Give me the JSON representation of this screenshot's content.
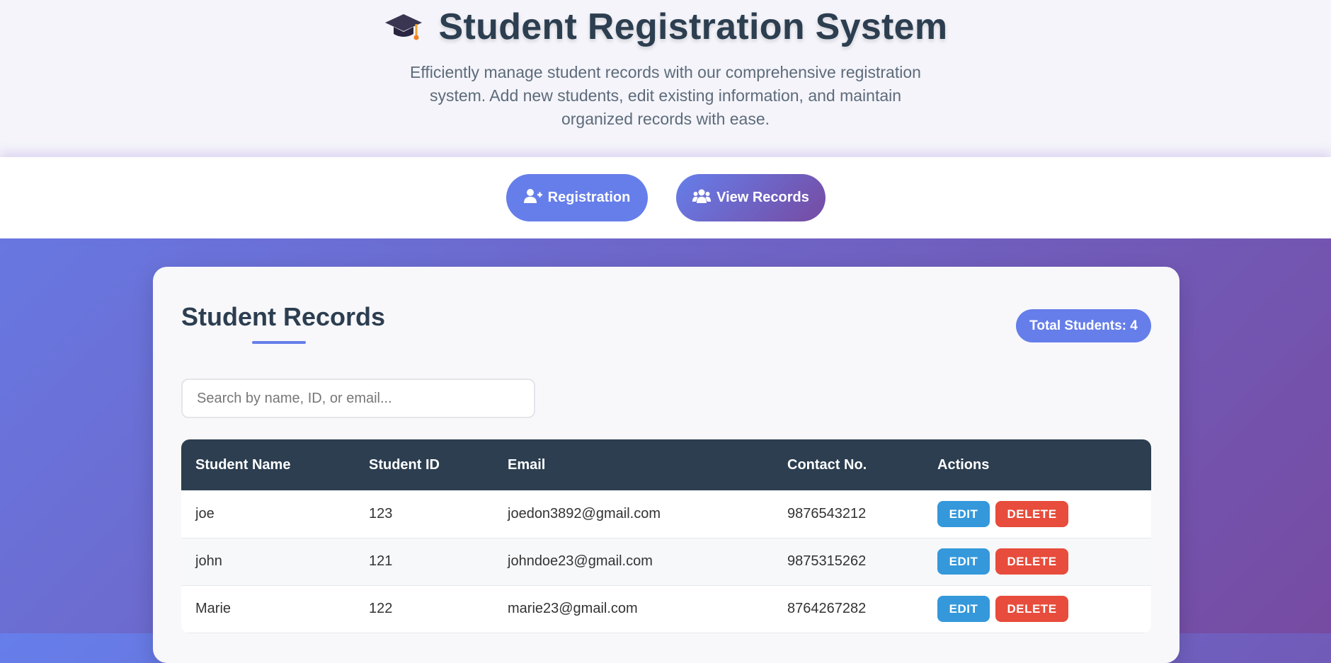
{
  "header": {
    "title": "Student Registration System",
    "subtitle": "Efficiently manage student records with our comprehensive registration system. Add new students, edit existing information, and maintain organized records with ease.",
    "icon": "graduation-cap-icon"
  },
  "nav": {
    "registration_label": "Registration",
    "view_records_label": "View Records",
    "registration_icon": "user-plus-icon",
    "view_records_icon": "users-icon"
  },
  "records": {
    "title": "Student Records",
    "total_label": "Total Students: 4",
    "search_placeholder": "Search by name, ID, or email...",
    "columns": [
      "Student Name",
      "Student ID",
      "Email",
      "Contact No.",
      "Actions"
    ],
    "rows": [
      {
        "name": "joe",
        "id": "123",
        "email": "joedon3892@gmail.com",
        "contact": "9876543212"
      },
      {
        "name": "john",
        "id": "121",
        "email": "johndoe23@gmail.com",
        "contact": "9875315262"
      },
      {
        "name": "Marie",
        "id": "122",
        "email": "marie23@gmail.com",
        "contact": "8764267282"
      }
    ],
    "edit_label": "EDIT",
    "delete_label": "DELETE"
  },
  "colors": {
    "accent": "#667eea",
    "accent_end": "#764ba2",
    "table_header": "#2c3e50",
    "edit": "#3498db",
    "delete": "#e74c3c"
  }
}
